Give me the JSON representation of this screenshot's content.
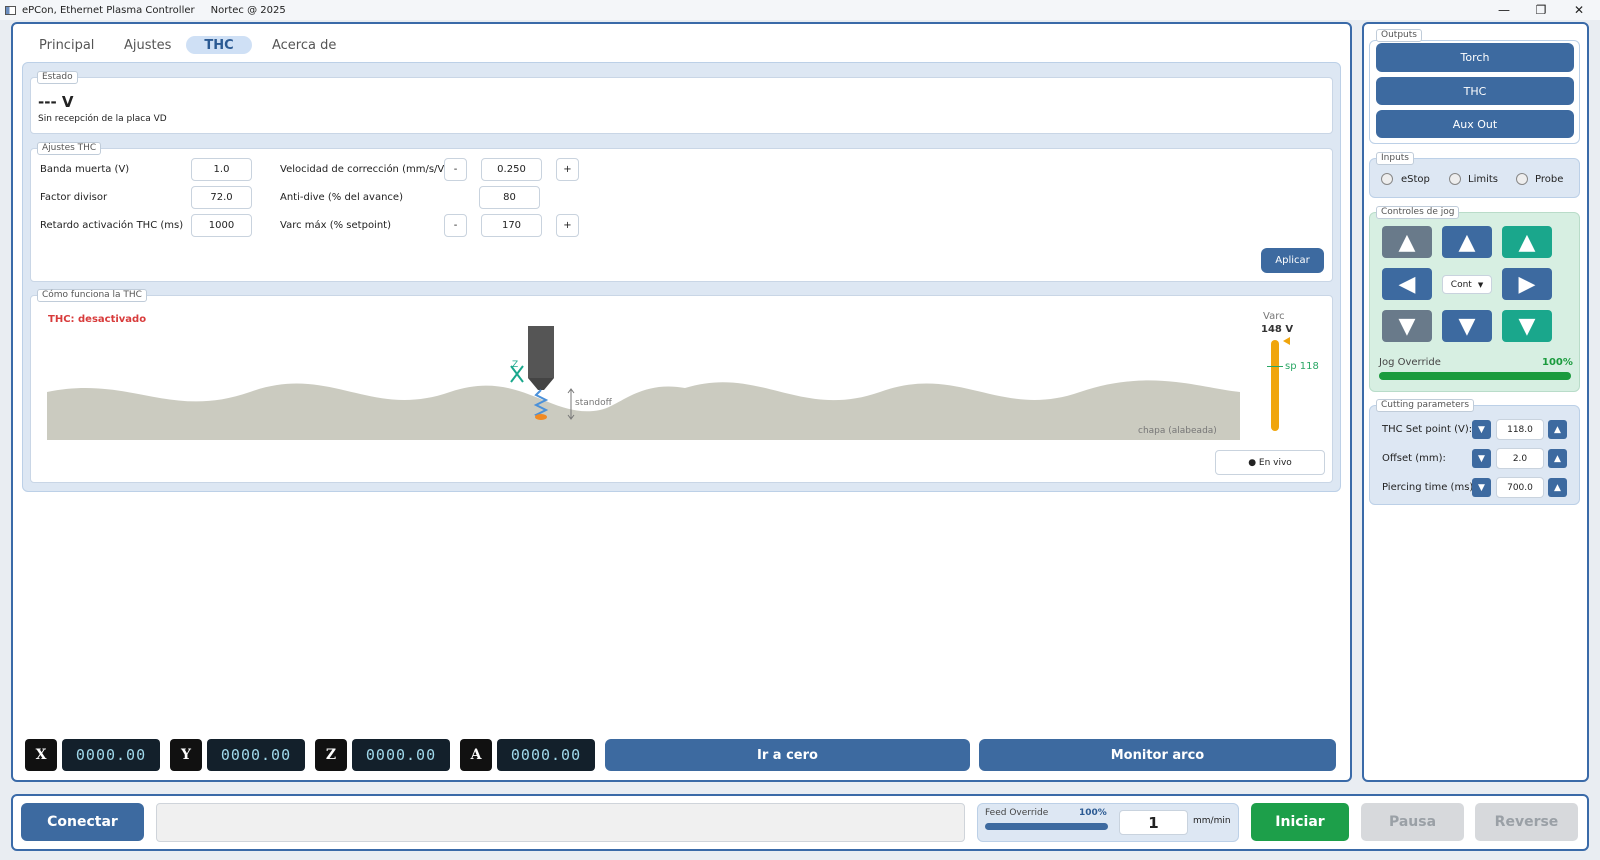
{
  "window": {
    "title": "ePCon, Ethernet Plasma Controller",
    "subtitle": "Nortec @ 2025",
    "minimize": "—",
    "restore": "❐",
    "close": "✕"
  },
  "tabs": [
    "Principal",
    "Ajustes",
    "THC",
    "Acerca de"
  ],
  "estado": {
    "legend": "Estado",
    "voltage": "--- V",
    "message": "Sin recepción de la placa VD"
  },
  "ajustes": {
    "legend": "Ajustes THC",
    "rows": [
      {
        "label": "Banda muerta (V)",
        "value": "1.0",
        "label2": "Velocidad de corrección (mm/s/V)",
        "value2": "0.250",
        "minus": "-",
        "plus": "+"
      },
      {
        "label": "Factor divisor",
        "value": "72.0",
        "label2": "Anti-dive (% del avance)",
        "value2": "80"
      },
      {
        "label": "Retardo activación THC (ms)",
        "value": "1000",
        "label2": "Varc máx (% setpoint)",
        "value2": "170",
        "minus": "-",
        "plus": "+"
      }
    ],
    "apply": "Aplicar"
  },
  "how": {
    "legend": "Cómo funciona la THC",
    "status": "THC: desactivado",
    "standoff": "standoff",
    "z": "Z",
    "sheet": "chapa (alabeada)",
    "varc_label": "Varc",
    "varc_value": "148 V",
    "sp": "sp 118",
    "live": "● En vivo",
    "colors": {
      "status": "#d83b3b",
      "bar": "#f0a50c",
      "sp": "#2aa765",
      "sheet": "#cbcbc0"
    }
  },
  "axes": [
    {
      "name": "X",
      "value": "0000.00"
    },
    {
      "name": "Y",
      "value": "0000.00"
    },
    {
      "name": "Z",
      "value": "0000.00"
    },
    {
      "name": "A",
      "value": "0000.00"
    }
  ],
  "actions": {
    "zero": "Ir a cero",
    "monitor": "Monitor arco"
  },
  "outputs": {
    "legend": "Outputs",
    "items": [
      "Torch",
      "THC",
      "Aux Out"
    ]
  },
  "inputs": {
    "legend": "Inputs",
    "items": [
      "eStop",
      "Limits",
      "Probe"
    ]
  },
  "jog": {
    "legend": "Controles de jog",
    "mode": "Cont",
    "override_label": "Jog Override",
    "override_value": "100%",
    "override_fraction": 1.0
  },
  "cutting": {
    "legend": "Cutting parameters",
    "rows": [
      {
        "label": "THC Set point (V):",
        "value": "118.0"
      },
      {
        "label": "Offset (mm):",
        "value": "2.0"
      },
      {
        "label": "Piercing time (ms):",
        "value": "700.0"
      }
    ]
  },
  "bottom": {
    "connect": "Conectar",
    "feed_label": "Feed Override",
    "feed_value": "100%",
    "feed_fraction": 1.0,
    "speed": "1",
    "unit": "mm/min",
    "start": "Iniciar",
    "pause": "Pausa",
    "reverse": "Reverse"
  }
}
